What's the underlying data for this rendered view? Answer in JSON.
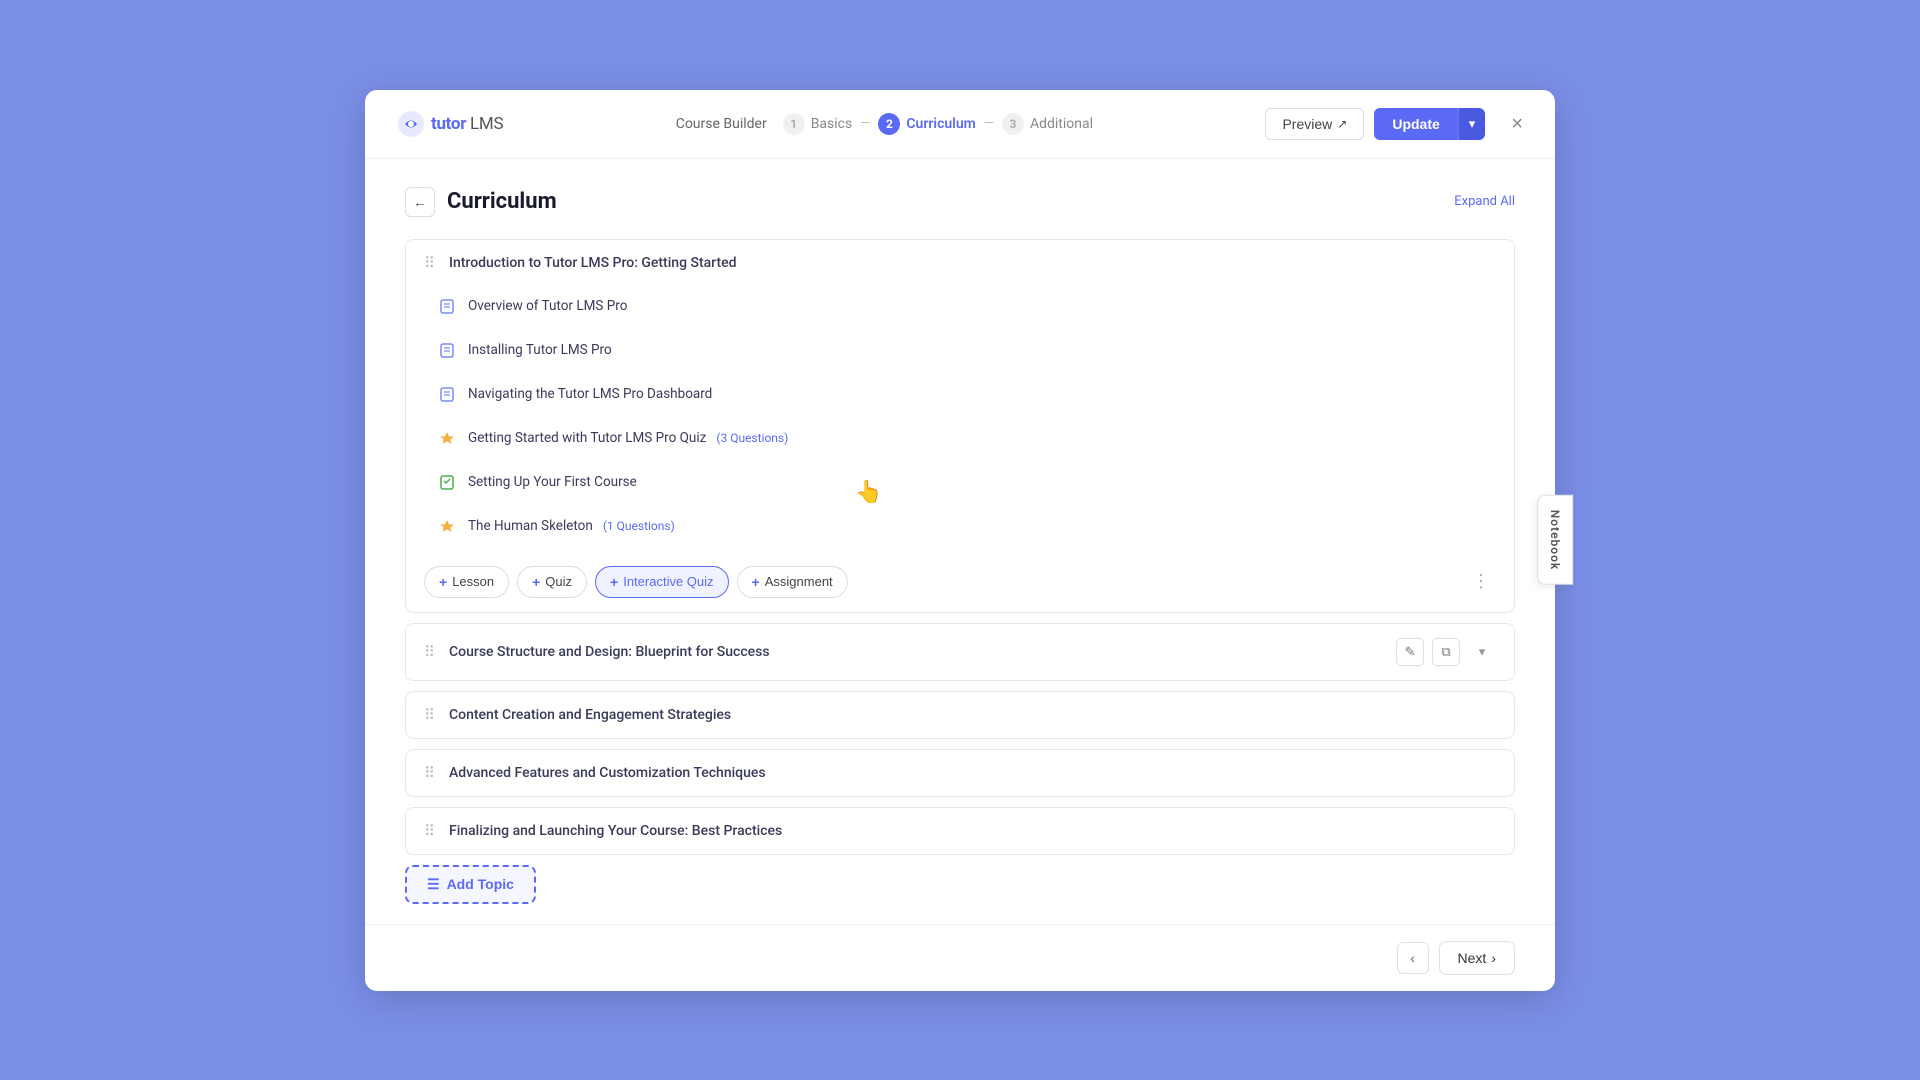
{
  "app": {
    "logo_text": "tutor",
    "logo_suffix": "LMS"
  },
  "header": {
    "breadcrumb": [
      {
        "step": "1",
        "label": "Basics",
        "state": "inactive"
      },
      {
        "step": "2",
        "label": "Curriculum",
        "state": "active"
      },
      {
        "step": "3",
        "label": "Additional",
        "state": "inactive"
      }
    ],
    "course_builder_label": "Course Builder",
    "preview_label": "Preview",
    "update_label": "Update",
    "close_label": "×"
  },
  "curriculum": {
    "title": "Curriculum",
    "expand_all": "Expand All",
    "topics": [
      {
        "id": "topic-1",
        "name": "Introduction to Tutor LMS Pro: Getting Started",
        "expanded": true,
        "lessons": [
          {
            "type": "lesson",
            "name": "Overview of Tutor LMS Pro"
          },
          {
            "type": "lesson",
            "name": "Installing Tutor LMS Pro"
          },
          {
            "type": "lesson",
            "name": "Navigating the Tutor LMS Pro Dashboard"
          },
          {
            "type": "quiz",
            "name": "Getting Started with Tutor LMS Pro Quiz",
            "badge": "(3 Questions)"
          },
          {
            "type": "assignment",
            "name": "Setting Up Your First Course"
          },
          {
            "type": "quiz",
            "name": "The Human Skeleton",
            "badge": "(1 Questions)"
          }
        ],
        "add_buttons": [
          {
            "label": "Lesson",
            "id": "add-lesson"
          },
          {
            "label": "Quiz",
            "id": "add-quiz"
          },
          {
            "label": "Interactive Quiz",
            "id": "add-interactive-quiz"
          },
          {
            "label": "Assignment",
            "id": "add-assignment"
          }
        ]
      },
      {
        "id": "topic-2",
        "name": "Course Structure and Design: Blueprint for Success",
        "expanded": false,
        "lessons": [],
        "add_buttons": []
      },
      {
        "id": "topic-3",
        "name": "Content Creation and Engagement Strategies",
        "expanded": false,
        "lessons": [],
        "add_buttons": []
      },
      {
        "id": "topic-4",
        "name": "Advanced Features and Customization Techniques",
        "expanded": false,
        "lessons": [],
        "add_buttons": []
      },
      {
        "id": "topic-5",
        "name": "Finalizing and Launching Your Course: Best Practices",
        "expanded": false,
        "lessons": [],
        "add_buttons": []
      }
    ],
    "add_topic_label": "Add Topic"
  },
  "footer": {
    "next_label": "Next"
  },
  "notebook": {
    "label": "Notebook"
  },
  "icons": {
    "drag": "⠿",
    "lesson": "📄",
    "quiz": "⭐",
    "assignment": "📋",
    "chevron_down": "▾",
    "chevron_up": "▴",
    "chevron_left": "‹",
    "chevron_right": "›",
    "edit": "✎",
    "copy": "⧉",
    "plus": "+",
    "external": "↗",
    "more": "⋮",
    "back": "←"
  }
}
